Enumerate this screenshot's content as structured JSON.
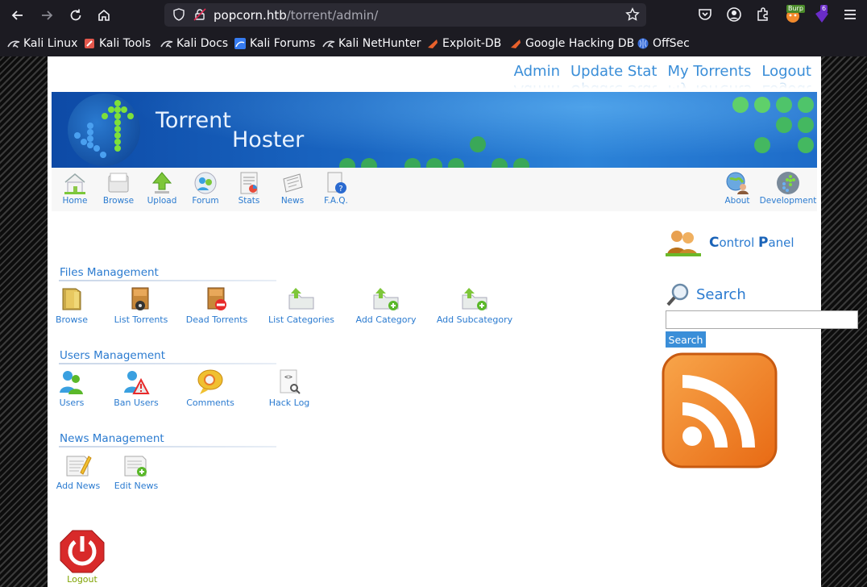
{
  "browser": {
    "url_host": "popcorn.htb",
    "url_path": "/torrent/admin/",
    "burp_label": "Burp",
    "ext_badge": "6",
    "bookmarks": [
      "Kali Linux",
      "Kali Tools",
      "Kali Docs",
      "Kali Forums",
      "Kali NetHunter",
      "Exploit-DB",
      "Google Hacking DB",
      "OffSec"
    ]
  },
  "topnav": [
    "Admin",
    "Update Stat",
    "My Torrents",
    "Logout"
  ],
  "brand": {
    "line1": "Torrent",
    "line2": "Hoster"
  },
  "mainnav": {
    "left": [
      {
        "label": "Home",
        "icon": "home-icon"
      },
      {
        "label": "Browse",
        "icon": "browse-icon"
      },
      {
        "label": "Upload",
        "icon": "upload-arrow-icon"
      },
      {
        "label": "Forum",
        "icon": "forum-icon"
      },
      {
        "label": "Stats",
        "icon": "stats-icon"
      },
      {
        "label": "News",
        "icon": "news-icon"
      },
      {
        "label": "F.A.Q.",
        "icon": "faq-icon"
      }
    ],
    "right": [
      {
        "label": "About",
        "icon": "about-icon"
      },
      {
        "label": "Development",
        "icon": "development-icon"
      }
    ]
  },
  "sections": {
    "files": {
      "title": "Files Management",
      "items": [
        "Browse",
        "List Torrents",
        "Dead Torrents",
        "List Categories",
        "Add Category",
        "Add Subcategory"
      ]
    },
    "users": {
      "title": "Users Management",
      "items": [
        "Users",
        "Ban Users",
        "Comments",
        "Hack Log"
      ]
    },
    "news": {
      "title": "News Management",
      "items": [
        "Add News",
        "Edit News"
      ]
    }
  },
  "sidebar": {
    "control_panel": {
      "first_c": "C",
      "rest1": "ontrol ",
      "first_p": "P",
      "rest2": "anel"
    },
    "search_title": "Search",
    "search_button": "Search"
  },
  "logout_label": "Logout",
  "colors": {
    "accent": "#2b7bd0",
    "link_blue": "#3a8ed8",
    "logout_green": "#7fa300",
    "rss_orange": "#f28a2c"
  }
}
